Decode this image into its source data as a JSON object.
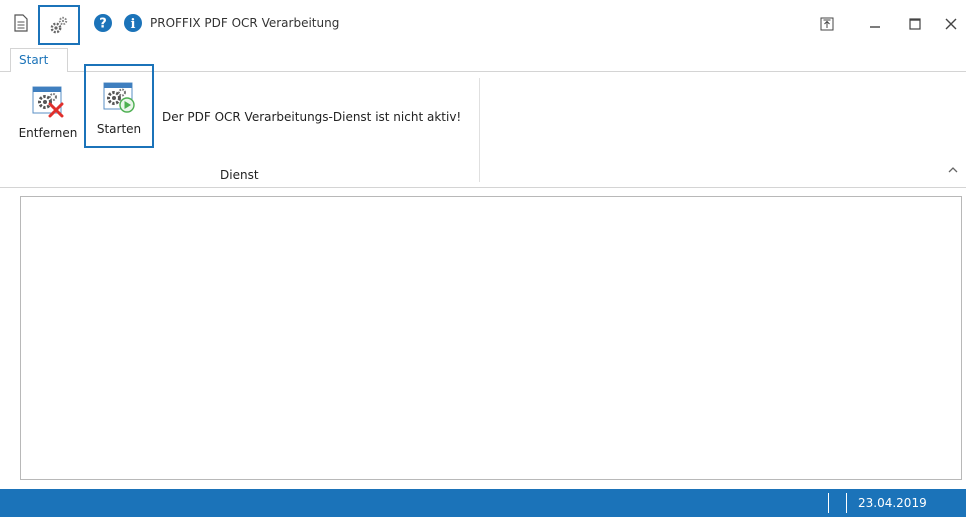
{
  "window": {
    "title": "PROFFIX PDF OCR Verarbeitung"
  },
  "quick_access": {
    "icons": [
      "document-icon",
      "gear-icon",
      "help-icon",
      "info-icon"
    ]
  },
  "tabs": [
    {
      "label": "Start",
      "active": true
    }
  ],
  "ribbon": {
    "buttons": [
      {
        "label": "Entfernen",
        "icon": "remove-service-icon"
      },
      {
        "label": "Starten",
        "icon": "start-service-icon"
      }
    ],
    "message": "Der PDF OCR Verarbeitungs-Dienst ist nicht aktiv!",
    "group_label": "Dienst"
  },
  "statusbar": {
    "date": "23.04.2019"
  },
  "colors": {
    "accent": "#1b73b9",
    "remove_red": "#e0302c",
    "play_green": "#4caf50"
  }
}
